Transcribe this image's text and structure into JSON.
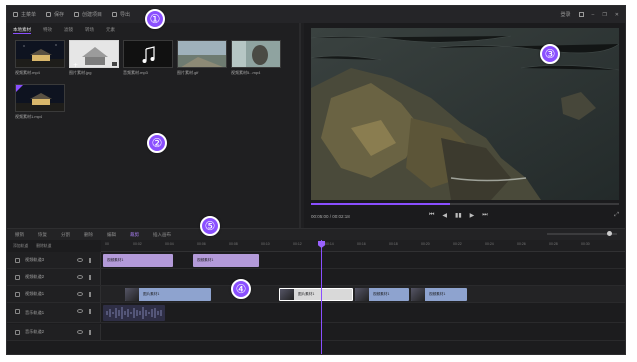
{
  "titlebar": {
    "items": [
      {
        "label": "主菜单",
        "icon": "menu-icon"
      },
      {
        "label": "保存",
        "icon": "save-icon"
      },
      {
        "label": "创建项目",
        "icon": "project-icon"
      },
      {
        "label": "导出",
        "icon": "export-icon"
      }
    ],
    "account": "登录",
    "window_controls": [
      "settings-icon",
      "minimize-icon",
      "restore-icon",
      "close-icon"
    ]
  },
  "markers": [
    "①",
    "②",
    "③",
    "④",
    "⑤"
  ],
  "library": {
    "tabs": [
      {
        "label": "本地素材",
        "active": true
      },
      {
        "label": "特效",
        "active": false
      },
      {
        "label": "滤镜",
        "active": false
      },
      {
        "label": "转场",
        "active": false
      },
      {
        "label": "元素",
        "active": false
      }
    ],
    "media": [
      {
        "name": "视频素材.mp4",
        "type": "video",
        "selected": false
      },
      {
        "name": "图片素材.jpg",
        "type": "image",
        "selected": true
      },
      {
        "name": "音频素材.mp3",
        "type": "audio",
        "selected": false
      },
      {
        "name": "图片素材.gif",
        "type": "image",
        "selected": false
      },
      {
        "name": "视频素材5...mp4",
        "type": "video",
        "selected": false
      },
      {
        "name": "视频素材1.mp4",
        "type": "video",
        "selected": false
      }
    ]
  },
  "preview": {
    "time": "00:05:00 / 00:02:18",
    "progress": 0.45,
    "controls": [
      "prev-frame-icon",
      "step-back-icon",
      "play-icon",
      "step-forward-icon",
      "next-frame-icon"
    ],
    "fullscreen_icon": "fullscreen-icon"
  },
  "toolbar": {
    "tools": [
      {
        "label": "撤销",
        "accent": false
      },
      {
        "label": "恢复",
        "accent": false
      },
      {
        "label": "分割",
        "accent": false
      },
      {
        "label": "删除",
        "accent": false
      },
      {
        "label": "编辑",
        "accent": false
      },
      {
        "label": "裁剪",
        "accent": true
      },
      {
        "label": "插入画布",
        "accent": false
      }
    ]
  },
  "timeline": {
    "head_labels": [
      "添加轨道",
      "删除轨道"
    ],
    "ruler": [
      "00",
      "00:02",
      "00:04",
      "00:06",
      "00:08",
      "00:10",
      "00:12",
      "00:14",
      "00:16",
      "00:18",
      "00:20",
      "00:22",
      "00:24",
      "00:26",
      "00:28",
      "00:30"
    ],
    "tracks": [
      {
        "name": "视频轨道3",
        "clips": [
          {
            "label": "视频素材1",
            "color": "#b39ad9"
          },
          {
            "label": "视频素材1",
            "color": "#b39ad9"
          }
        ]
      },
      {
        "name": "视频轨道2",
        "clips": []
      },
      {
        "name": "视频轨道1",
        "clips": [
          {
            "label": "图片素材1",
            "color": "#8ea3cf"
          },
          {
            "label": "图片素材1",
            "color": "#d9d9d9"
          },
          {
            "label": "视频素材1",
            "color": "#8ea3cf"
          },
          {
            "label": "视频素材1",
            "color": "#8ea3cf"
          }
        ]
      },
      {
        "name": "音乐轨道1",
        "clips": [
          {
            "label": "",
            "color": "#3a3a55"
          }
        ]
      },
      {
        "name": "音乐轨道2",
        "clips": []
      }
    ]
  },
  "colors": {
    "accent": "#8a4fff",
    "background": "#1f1f21"
  }
}
